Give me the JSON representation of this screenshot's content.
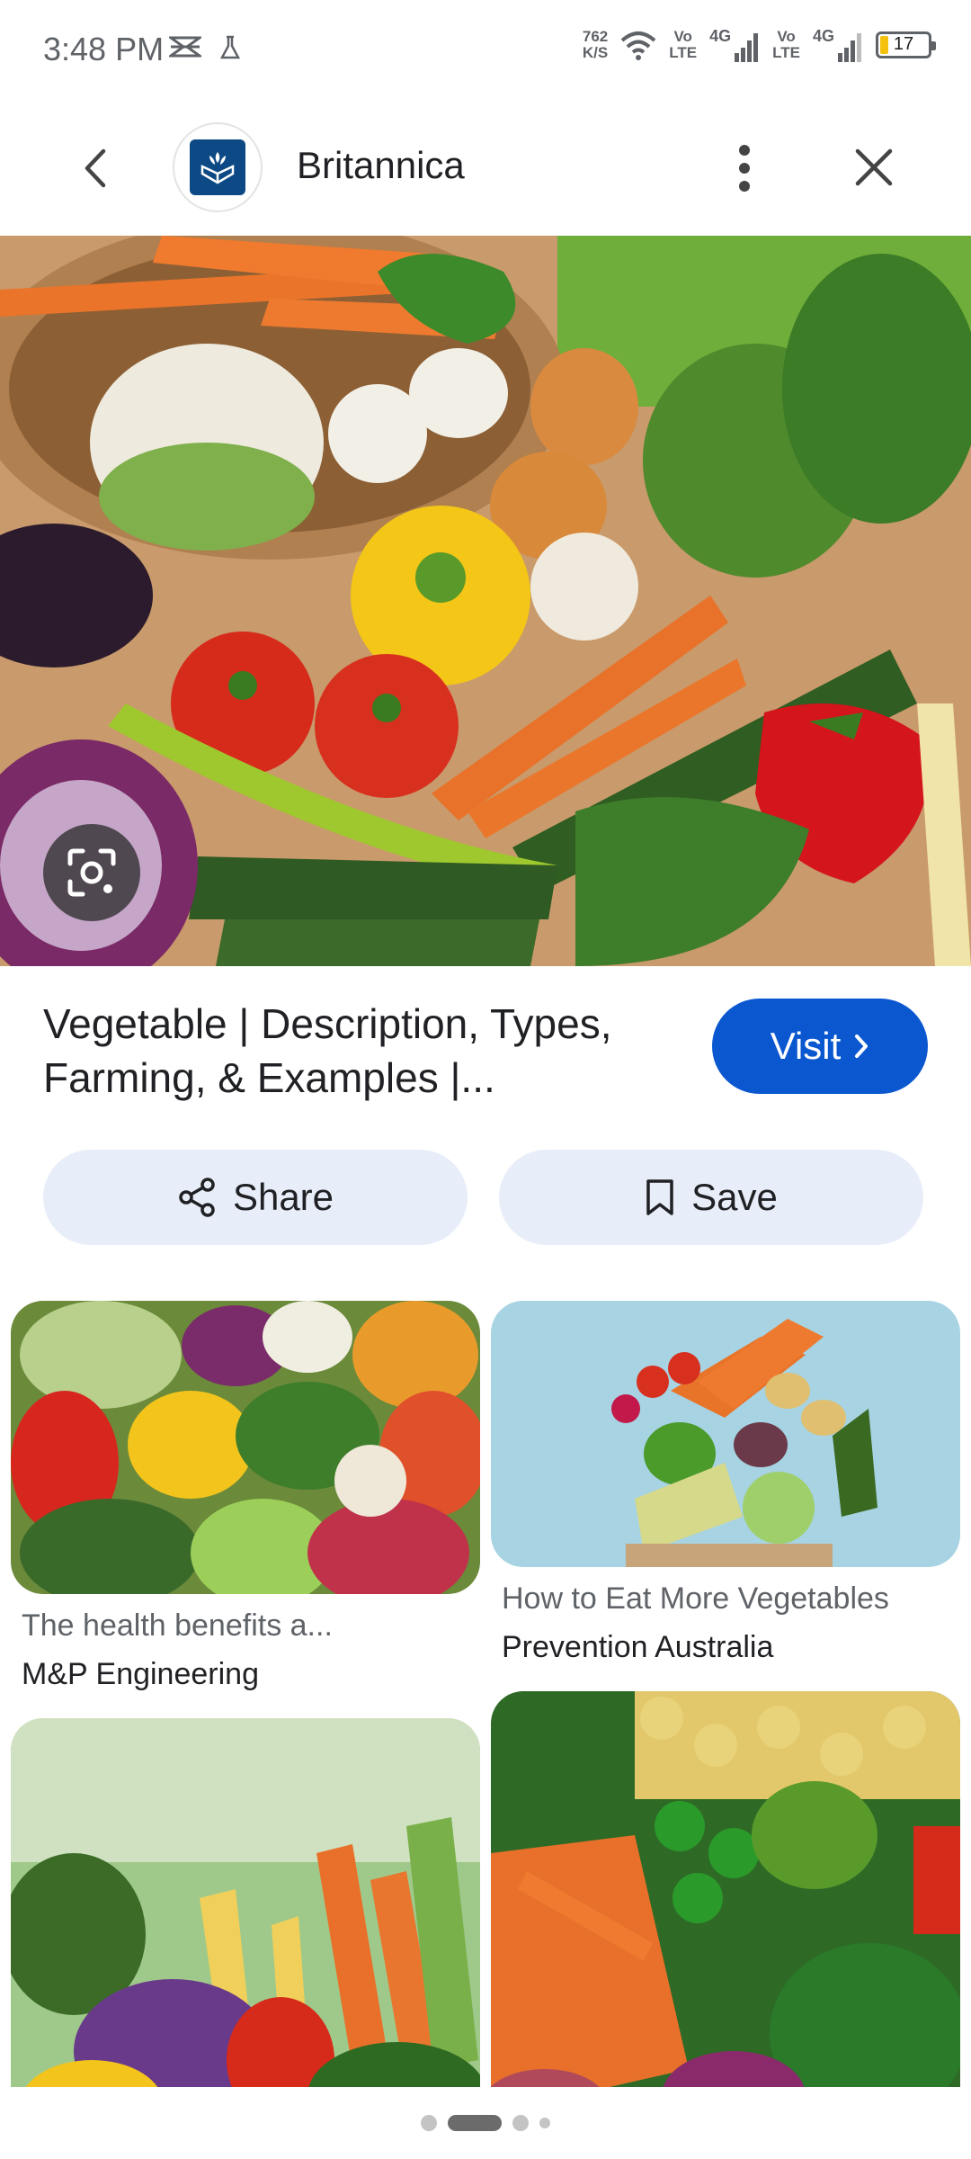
{
  "status_bar": {
    "time": "3:48 PM",
    "net_speed_value": "762",
    "net_speed_unit": "K/S",
    "volte_1_top": "Vo",
    "volte_1_bottom": "LTE",
    "sim1_label": "4G",
    "volte_2_top": "Vo",
    "volte_2_bottom": "LTE",
    "sim2_label": "4G",
    "battery_level": "17",
    "battery_fraction": 0.17,
    "battery_color": "#f4c20d",
    "icons": [
      "notification-icon",
      "beaker-icon",
      "wifi-icon",
      "signal-icon",
      "battery-icon"
    ]
  },
  "app_bar": {
    "site_name": "Britannica",
    "icons": [
      "back-arrow-icon",
      "britannica-logo-icon",
      "more-vert-icon",
      "close-icon"
    ]
  },
  "result": {
    "title_line1": "Vegetable | Description, Types,",
    "title_line2": "Farming, & Examples |...",
    "visit_label": "Visit",
    "share_label": "Share",
    "save_label": "Save",
    "accent_color": "#0b57d0"
  },
  "related": [
    {
      "title": "The health benefits a...",
      "source": "M&P Engineering"
    },
    {
      "title": "How to Eat More Vegetables",
      "source": "Prevention Australia"
    },
    {
      "title": "",
      "source": ""
    },
    {
      "title": "",
      "source": ""
    }
  ],
  "pager": {
    "pages": 4,
    "active_index": 1
  }
}
